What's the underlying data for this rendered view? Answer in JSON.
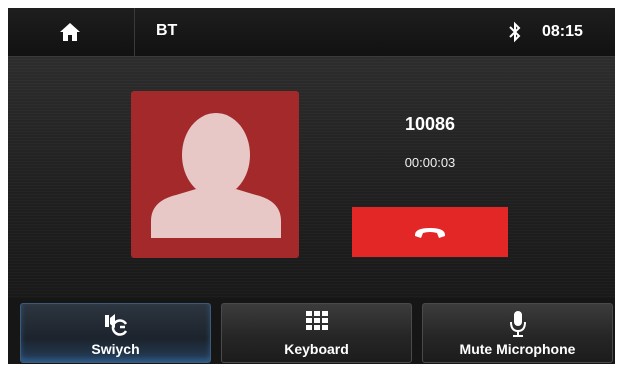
{
  "header": {
    "title": "BT",
    "time": "08:15"
  },
  "call": {
    "number": "10086",
    "duration": "00:00:03"
  },
  "bottom": {
    "buttons": [
      {
        "label": "Swiych",
        "icon": "switch-audio-icon",
        "active": true
      },
      {
        "label": "Keyboard",
        "icon": "keypad-icon",
        "active": false
      },
      {
        "label": "Mute Microphone",
        "icon": "microphone-icon",
        "active": false
      }
    ]
  },
  "colors": {
    "avatar": "#a3292b",
    "hangup": "#e32626",
    "active_glow": "#3c82c8"
  },
  "icons": {
    "home": "home-icon",
    "bluetooth": "bluetooth-icon",
    "contact": "contact-silhouette-icon",
    "hangup": "hang-up-icon"
  }
}
